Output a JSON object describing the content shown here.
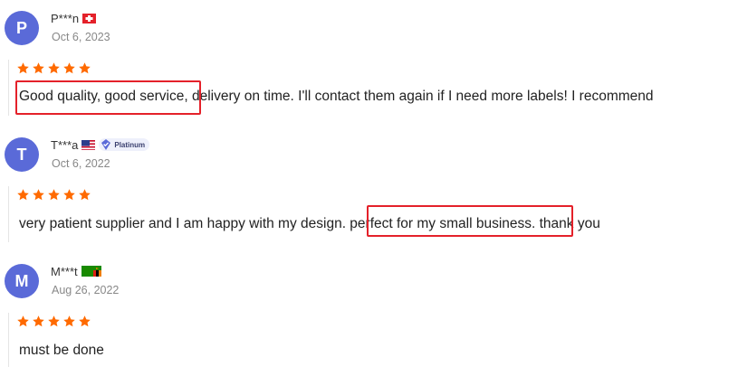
{
  "reviews": [
    {
      "initial": "P",
      "name": "P***n",
      "country_flag": "switzerland-flag",
      "date": "Oct 6, 2023",
      "rating": 5,
      "text": "Good quality, good service, delivery on time. I'll contact them again if I need more labels! I recommend",
      "highlighted": "Good quality, good service"
    },
    {
      "initial": "T",
      "name": "T***a",
      "country_flag": "usa-flag",
      "badge": "Platinum",
      "date": "Oct 6, 2022",
      "rating": 5,
      "text": "very patient supplier and I am happy with my design. perfect for my small business. thank you",
      "highlighted": "perfect for my small business."
    },
    {
      "initial": "M",
      "name": "M***t",
      "country_flag": "zambia-flag",
      "date": "Aug 26, 2022",
      "rating": 5,
      "text": "must be done"
    }
  ],
  "colors": {
    "avatar": "#5a6ad8",
    "star": "#ff6a00",
    "highlight_border": "#e4212a"
  }
}
